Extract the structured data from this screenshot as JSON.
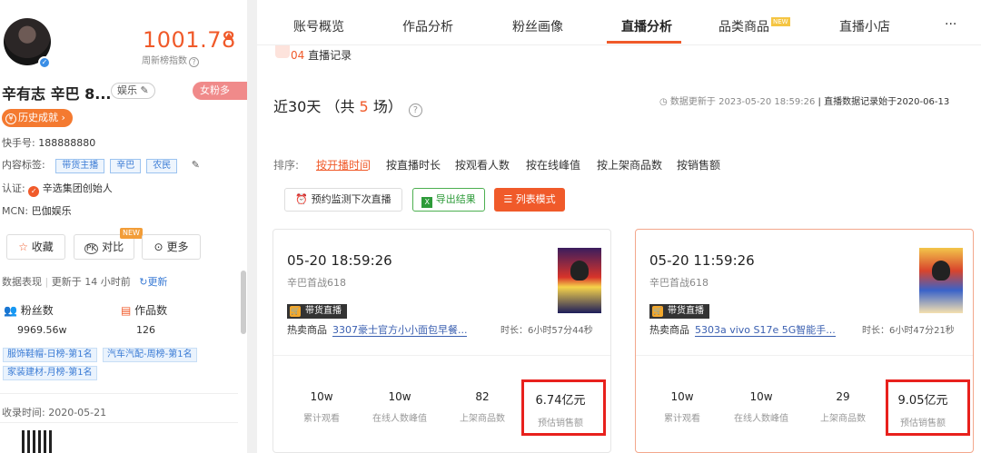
{
  "profile": {
    "score": "1001.78",
    "score_label": "周新榜指数",
    "name": "辛有志 辛巴 8...",
    "category": "娱乐",
    "female_tag": "女粉多",
    "history_btn": "历史成就",
    "kuaishou_label": "快手号:",
    "kuaishou_id": "188888880",
    "content_tags_label": "内容标签:",
    "content_tags": [
      "带货主播",
      "辛巴",
      "农民"
    ],
    "verify_label": "认证:",
    "verify_value": "辛选集团创始人",
    "mcn_label": "MCN:",
    "mcn_value": "巴伽娱乐",
    "buttons": {
      "favorite": "收藏",
      "compare": "对比",
      "more": "更多",
      "new": "NEW"
    },
    "data_perf": "数据表现",
    "updated": "更新于 14 小时前",
    "refresh": "更新",
    "fans_label": "粉丝数",
    "fans_value": "9969.56w",
    "works_label": "作品数",
    "works_value": "126",
    "rank_tags": [
      "服饰鞋帽-日榜-第1名",
      "汽车汽配-周榜-第1名",
      "家装建材-月榜-第1名"
    ],
    "collected": "收录时间: 2020-05-21"
  },
  "nav": {
    "tabs": [
      "账号概览",
      "作品分析",
      "粉丝画像",
      "直播分析",
      "品类商品",
      "直播小店",
      "···"
    ],
    "new": "NEW"
  },
  "section": {
    "num": "04",
    "title": "直播记录"
  },
  "period": {
    "prefix": "近30天 （共",
    "count": "5",
    "suffix": "场）"
  },
  "update_info": {
    "prefix": "数据更新于",
    "time": "2023-05-20 18:59:26",
    "sep": "|",
    "record": "直播数据记录始于2020-06-13"
  },
  "sort": {
    "label": "排序:",
    "options": [
      "按开播时间",
      "按直播时长",
      "按观看人数",
      "按在线峰值",
      "按上架商品数",
      "按销售额"
    ]
  },
  "actions": {
    "monitor": "预约监测下次直播",
    "export": "导出结果",
    "list_mode": "列表模式"
  },
  "cards": [
    {
      "time": "05-20 18:59:26",
      "title": "辛巴首战618",
      "badge": "带货直播",
      "hot_label": "热卖商品",
      "hot_item": "3307豪士官方小小面包早餐...",
      "duration": "时长：6小时57分44秒",
      "metrics": [
        {
          "value": "10w",
          "label": "累计观看"
        },
        {
          "value": "10w",
          "label": "在线人数峰值"
        },
        {
          "value": "82",
          "label": "上架商品数"
        },
        {
          "value": "6.74亿元",
          "label": "预估销售额"
        }
      ]
    },
    {
      "time": "05-20 11:59:26",
      "title": "辛巴首战618",
      "badge": "带货直播",
      "hot_label": "热卖商品",
      "hot_item": "5303a vivo S17e 5G智能手...",
      "duration": "时长：6小时47分21秒",
      "metrics": [
        {
          "value": "10w",
          "label": "累计观看"
        },
        {
          "value": "10w",
          "label": "在线人数峰值"
        },
        {
          "value": "29",
          "label": "上架商品数"
        },
        {
          "value": "9.05亿元",
          "label": "预估销售额"
        }
      ]
    }
  ],
  "colors": {
    "accent": "#f05a2a",
    "highlight_box": "#e8211d",
    "link_blue": "#3a7bd5"
  }
}
